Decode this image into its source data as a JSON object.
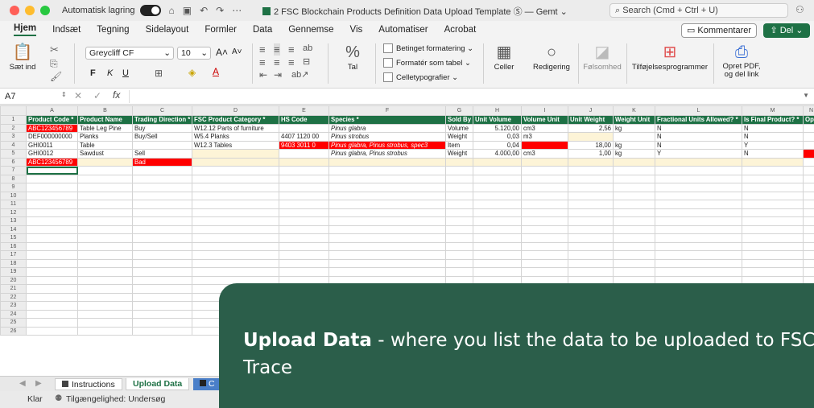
{
  "titlebar": {
    "autosave_label": "Automatisk lagring",
    "doc_title": "2 FSC Blockchain Products Definition Data Upload Template",
    "doc_suffix": "Ⓢ — Gemt ⌄",
    "search_placeholder": "Search (Cmd + Ctrl + U)",
    "traffic_colors": [
      "#ff5f57",
      "#febc2e",
      "#28c840"
    ]
  },
  "ribbon_tabs": [
    "Hjem",
    "Indsæt",
    "Tegning",
    "Sidelayout",
    "Formler",
    "Data",
    "Gennemse",
    "Vis",
    "Automatiser",
    "Acrobat"
  ],
  "buttons": {
    "comments": "Kommentarer",
    "share": "Del"
  },
  "ribbon": {
    "paste": "Sæt ind",
    "font_name": "Greycliff CF",
    "font_size": "10",
    "number": "Tal",
    "cond_format": "Betinget formatering",
    "format_table": "Formatér som tabel",
    "cell_styles": "Celletypografier",
    "cells": "Celler",
    "editing": "Redigering",
    "sensitivity": "Følsomhed",
    "addins": "Tilføjelsesprogrammer",
    "pdf_line1": "Opret PDF,",
    "pdf_line2": "og del link",
    "bold": "F",
    "italic": "K",
    "underline": "U"
  },
  "formula_bar": {
    "name_box": "A7",
    "fx": "fx"
  },
  "columns": [
    "A",
    "B",
    "C",
    "D",
    "E",
    "F",
    "G",
    "H",
    "I",
    "J",
    "K",
    "L",
    "M",
    "N"
  ],
  "headers": [
    "Product Code *",
    "Product Name",
    "Trading Direction *",
    "FSC Product Category *",
    "HS Code",
    "Species *",
    "Sold By *",
    "Unit Volume",
    "Volume Unit",
    "Unit Weight",
    "Weight Unit",
    "Fractional Units Allowed? *",
    "Is Final Product? *",
    "Op"
  ],
  "rows": [
    [
      "ABC123456789",
      "Table Leg Pine",
      "Buy",
      "W12.12 Parts of furniture",
      "",
      "Pinus glabra",
      "Volume",
      "5.120,00",
      "cm3",
      "2,56",
      "kg",
      "N",
      "N",
      ""
    ],
    [
      "DEF000000000",
      "Planks",
      "Buy/Sell",
      "W5.4 Planks",
      "4407 1120 00",
      "Pinus strobus",
      "Weight",
      "0,03",
      "m3",
      "",
      "",
      "N",
      "N",
      ""
    ],
    [
      "GHI0011",
      "Table",
      "",
      "W12.3 Tables",
      "9403 3011 0",
      "Pinus glabra, Pinus strobus, spec3",
      "Item",
      "0,04",
      "",
      "18,00",
      "kg",
      "N",
      "Y",
      ""
    ],
    [
      "GHI0012",
      "Sawdust",
      "Sell",
      "",
      "",
      "Pinus glabra, Pinus strobus",
      "Weight",
      "4.000,00",
      "cm3",
      "1,00",
      "kg",
      "Y",
      "N",
      ""
    ],
    [
      "ABC123456789",
      "",
      "Bad",
      "",
      "",
      "",
      "",
      "",
      "",
      "",
      "",
      "",
      "",
      ""
    ]
  ],
  "row_numbers": [
    "1",
    "2",
    "3",
    "4",
    "5",
    "6",
    "7",
    "8",
    "9",
    "10",
    "11",
    "12",
    "13",
    "14",
    "15",
    "16",
    "17",
    "18",
    "19",
    "20",
    "21",
    "22",
    "23",
    "24",
    "25",
    "26"
  ],
  "sheet_tabs": [
    "Instructions",
    "Upload Data",
    "C"
  ],
  "status": {
    "ready": "Klar",
    "accessibility": "Tilgængelighed: Undersøg"
  },
  "overlay": {
    "bold": "Upload Data",
    "rest": " - where you list the data to be uploaded to FSC Trace"
  }
}
